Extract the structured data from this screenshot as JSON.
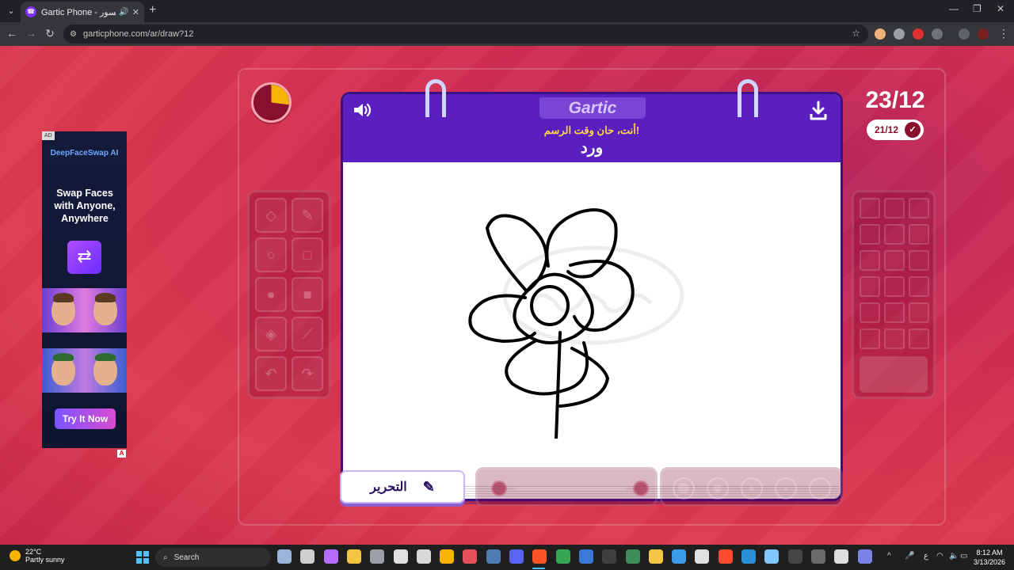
{
  "browser": {
    "tab_title": "Gartic Phone - الهاتف المكسور",
    "url": "garticphone.com/ar/draw?12",
    "new_tab_glyph": "+",
    "window_controls": [
      "—",
      "❐",
      "✕"
    ]
  },
  "ad": {
    "badge": "AD",
    "brand": "DeepFaceSwap AI",
    "headline": "Swap Faces with Anyone, Anywhere",
    "cta": "Try It Now"
  },
  "game": {
    "logo": "Gartic",
    "prompt": "أنت، حان وقت الرسم!",
    "word": "ورد",
    "round": "23/12",
    "done_count": "21/12",
    "timer_fraction": 0.27,
    "edit_label": "التحرير",
    "colors": {
      "accent": "#5a1fbe",
      "bg": "#d42f52",
      "timer": "#f5b400"
    },
    "tools": [
      {
        "name": "eraser-icon",
        "glyph": "◇"
      },
      {
        "name": "pencil-icon",
        "glyph": "✎"
      },
      {
        "name": "circle-outline-icon",
        "glyph": "○"
      },
      {
        "name": "square-outline-icon",
        "glyph": "□"
      },
      {
        "name": "circle-filled-icon",
        "glyph": "●"
      },
      {
        "name": "square-filled-icon",
        "glyph": "■"
      },
      {
        "name": "fill-bucket-icon",
        "glyph": "◈"
      },
      {
        "name": "line-icon",
        "glyph": "⟋"
      },
      {
        "name": "undo-icon",
        "glyph": "↶"
      },
      {
        "name": "redo-icon",
        "glyph": "↷"
      }
    ]
  },
  "taskbar": {
    "temperature": "22°C",
    "weather": "Partly sunny",
    "search_placeholder": "Search",
    "time": "8:12 AM",
    "date": "3/13/2026"
  }
}
